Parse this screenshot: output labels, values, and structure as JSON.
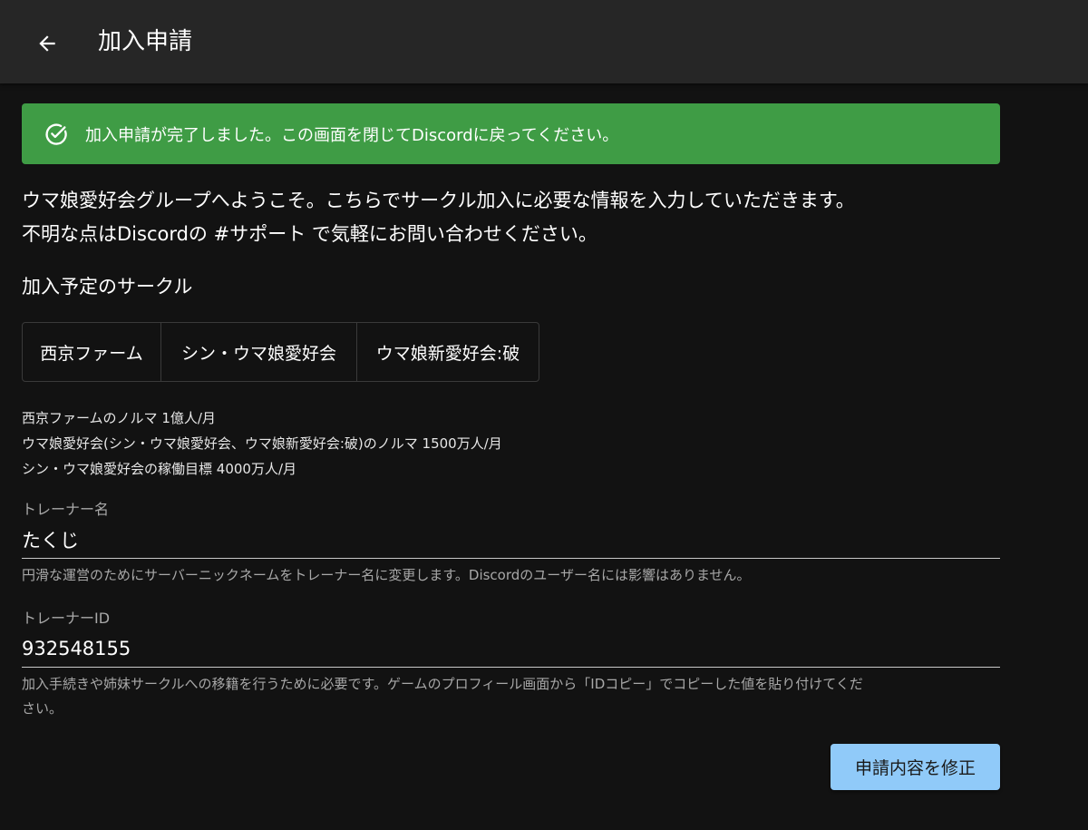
{
  "appbar": {
    "title": "加入申請",
    "back_icon": "arrow-left-icon"
  },
  "alert": {
    "icon": "check-circle-icon",
    "message": "加入申請が完了しました。この画面を閉じてDiscordに戻ってください。",
    "color": "#3f9c45"
  },
  "intro": {
    "line1": "ウマ娘愛好会グループへようこそ。こちらでサークル加入に必要な情報を入力していただきます。",
    "line2": "不明な点はDiscordの #サポート で気軽にお問い合わせください。"
  },
  "circles": {
    "title": "加入予定のサークル",
    "options": [
      "西京ファーム",
      "シン・ウマ娘愛好会",
      "ウマ娘新愛好会:破"
    ]
  },
  "quota": {
    "line1": "西京ファームのノルマ 1億人/月",
    "line2": "ウマ娘愛好会(シン・ウマ娘愛好会、ウマ娘新愛好会:破)のノルマ 1500万人/月",
    "line3": "シン・ウマ娘愛好会の稼働目標 4000万人/月"
  },
  "trainer_name": {
    "label": "トレーナー名",
    "value": "たくじ",
    "help": "円滑な運営のためにサーバーニックネームをトレーナー名に変更します。Discordのユーザー名には影響はありません。"
  },
  "trainer_id": {
    "label": "トレーナーID",
    "value": "932548155",
    "help_line1": "加入手続きや姉妹サークルへの移籍を行うために必要です。ゲームのプロフィール画面から「IDコピー」でコピーした値を貼り付けてくだ",
    "help_line2": "さい。"
  },
  "submit": {
    "label": "申請内容を修正",
    "color": "#90caf9"
  }
}
